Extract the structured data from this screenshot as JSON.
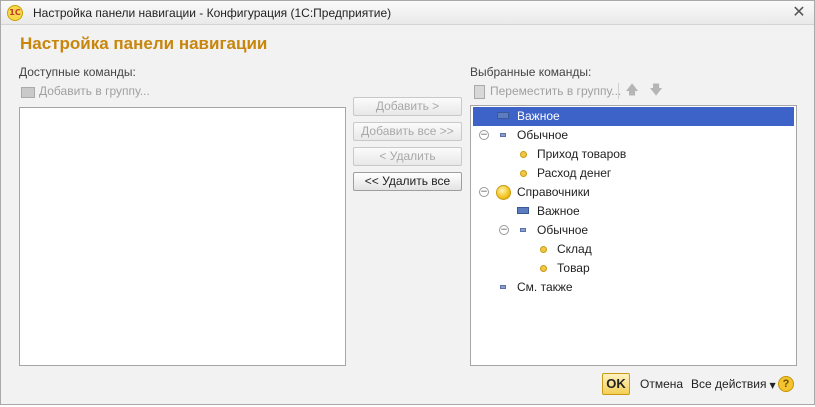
{
  "window": {
    "title": "Настройка панели навигации - Конфигурация  (1С:Предприятие)",
    "logo_text": "1С",
    "close_glyph": "✕"
  },
  "form": {
    "title": "Настройка панели навигации"
  },
  "left": {
    "label": "Доступные команды:",
    "add_to_group": "Добавить в группу..."
  },
  "middle": {
    "add": "Добавить >",
    "add_all": "Добавить все >>",
    "remove": "< Удалить",
    "remove_all": "<< Удалить все"
  },
  "right": {
    "label": "Выбранные команды:",
    "move_to_group": "Переместить в группу...",
    "up_glyph": "🡅",
    "down_glyph": "🡇",
    "tree": [
      {
        "text": "Важное",
        "level": 0,
        "icon": "section-icon",
        "selected": true
      },
      {
        "text": "Обычное",
        "level": 0,
        "icon": "section-small-icon",
        "toggle": "−"
      },
      {
        "text": "Приход товаров",
        "level": 1,
        "icon": "command-dot-icon"
      },
      {
        "text": "Расход денег",
        "level": 1,
        "icon": "command-dot-icon"
      },
      {
        "text": "Справочники",
        "level": 0,
        "icon": "group-icon",
        "toggle": "−"
      },
      {
        "text": "Важное",
        "level": 1,
        "icon": "section-icon"
      },
      {
        "text": "Обычное",
        "level": 1,
        "icon": "section-small-icon",
        "toggle": "−"
      },
      {
        "text": "Склад",
        "level": 2,
        "icon": "command-dot-icon"
      },
      {
        "text": "Товар",
        "level": 2,
        "icon": "command-dot-icon"
      },
      {
        "text": "См. также",
        "level": 0,
        "icon": "section-small-icon"
      }
    ]
  },
  "footer": {
    "ok": "OK",
    "cancel": "Отмена",
    "all_actions": "Все действия",
    "dropdown_glyph": "▼",
    "help": "?"
  },
  "colors": {
    "accent_title": "#c8860d",
    "selection": "#3d62c8"
  }
}
